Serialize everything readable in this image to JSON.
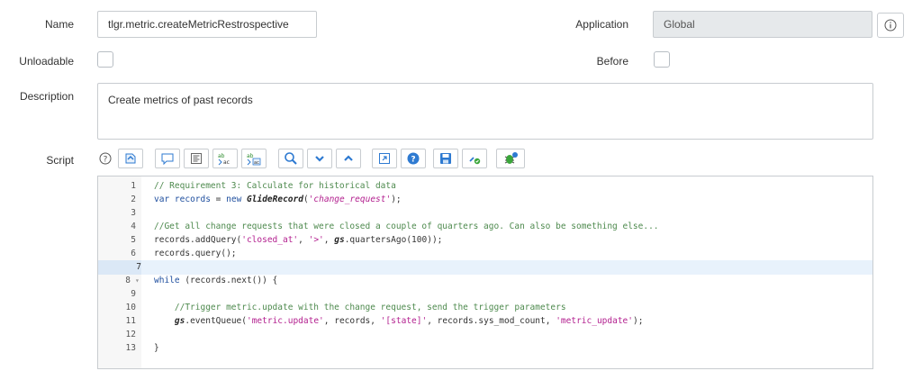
{
  "form": {
    "name_label": "Name",
    "name_value": "tlgr.metric.createMetricRestrospective",
    "application_label": "Application",
    "application_value": "Global",
    "unloadable_label": "Unloadable",
    "before_label": "Before",
    "description_label": "Description",
    "description_value": "Create metrics of past records",
    "script_label": "Script"
  },
  "toolbar": {
    "buttons": [
      "help-icon",
      "script-include-icon",
      "comment-icon",
      "format-icon",
      "replace-icon",
      "replace-all-icon",
      "search-icon",
      "next-icon",
      "previous-icon",
      "fullscreen-icon",
      "context-help-icon",
      "save-icon",
      "script-debug-icon",
      "syntax-check-icon"
    ]
  },
  "colors": {
    "accent": "#2e7ad1",
    "active_line": "#e8f2fc",
    "comment": "#4e8a4e",
    "string": "#b3208f",
    "keyword": "#1e4e9e"
  },
  "editor": {
    "active_line": 7,
    "lines": [
      {
        "n": "1",
        "text": "// Requirement 3: Calculate for historical data"
      },
      {
        "n": "2",
        "text": "var records = new GlideRecord('change_request');"
      },
      {
        "n": "3",
        "text": ""
      },
      {
        "n": "4",
        "text": "//Get all change requests that were closed a couple of quarters ago. Can also be something else..."
      },
      {
        "n": "5",
        "text": "records.addQuery('closed_at', '>', gs.quartersAgo(100));"
      },
      {
        "n": "6",
        "text": "records.query();"
      },
      {
        "n": "7",
        "text": ""
      },
      {
        "n": "8",
        "text": "while (records.next()) {"
      },
      {
        "n": "9",
        "text": ""
      },
      {
        "n": "10",
        "text": "    //Trigger metric.update with the change request, send the trigger parameters"
      },
      {
        "n": "11",
        "text": "    gs.eventQueue('metric.update', records, '[state]', records.sys_mod_count, 'metric_update');"
      },
      {
        "n": "12",
        "text": ""
      },
      {
        "n": "13",
        "text": "}"
      }
    ]
  }
}
